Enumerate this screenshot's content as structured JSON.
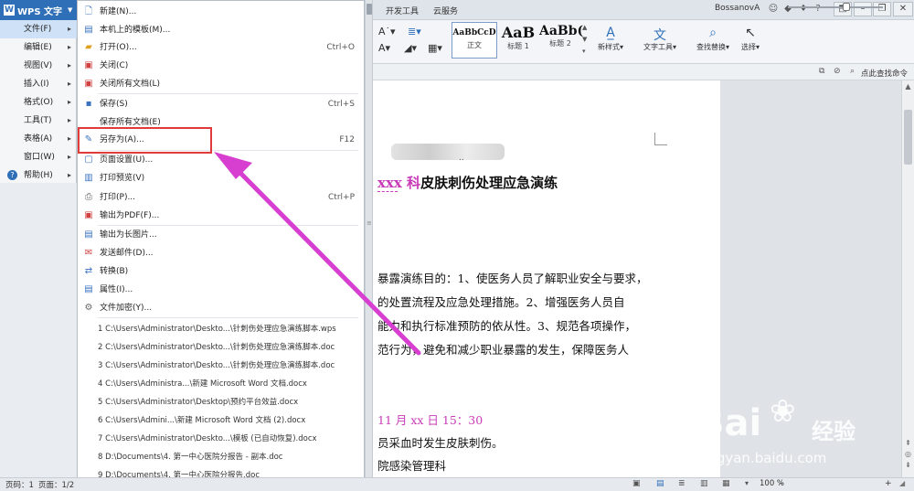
{
  "app": {
    "name": "WPS 文字"
  },
  "ribbon_tabs": [
    "开发工具",
    "云服务"
  ],
  "user": {
    "name": "BossanovA"
  },
  "styles": [
    {
      "preview": "AaBbCcD",
      "label": "正文"
    },
    {
      "preview": "AaB",
      "label": "标题 1"
    },
    {
      "preview": "AaBb(",
      "label": "标题 2"
    }
  ],
  "ribbon_buttons": {
    "new_style": "新样式",
    "text_tools": "文字工具",
    "find_replace": "查找替换",
    "select": "选择"
  },
  "command_hint": "点此查找命令",
  "categories": [
    {
      "label": "文件(F)",
      "icon": "",
      "selected": true
    },
    {
      "label": "编辑(E)",
      "icon": ""
    },
    {
      "label": "视图(V)",
      "icon": ""
    },
    {
      "label": "插入(I)",
      "icon": ""
    },
    {
      "label": "格式(O)",
      "icon": ""
    },
    {
      "label": "工具(T)",
      "icon": ""
    },
    {
      "label": "表格(A)",
      "icon": ""
    },
    {
      "label": "窗口(W)",
      "icon": ""
    },
    {
      "label": "帮助(H)",
      "icon": "help-icon"
    }
  ],
  "menu": {
    "items": [
      {
        "label": "新建(N)...",
        "shortcut": "",
        "icon": "new-doc-icon"
      },
      {
        "label": "本机上的模板(M)...",
        "shortcut": "",
        "icon": "template-icon"
      },
      {
        "label": "打开(O)...",
        "shortcut": "Ctrl+O",
        "icon": "open-folder-icon"
      },
      {
        "label": "关闭(C)",
        "shortcut": "",
        "icon": "close-doc-icon"
      },
      {
        "label": "关闭所有文档(L)",
        "shortcut": "",
        "icon": "close-all-icon"
      },
      {
        "label": "保存(S)",
        "shortcut": "Ctrl+S",
        "icon": "save-icon"
      },
      {
        "label": "保存所有文档(E)",
        "shortcut": "",
        "icon": ""
      },
      {
        "label": "另存为(A)...",
        "shortcut": "F12",
        "icon": "save-as-icon"
      },
      {
        "label": "页面设置(U)...",
        "shortcut": "",
        "icon": "page-setup-icon"
      },
      {
        "label": "打印预览(V)",
        "shortcut": "",
        "icon": "print-preview-icon"
      },
      {
        "label": "打印(P)...",
        "shortcut": "Ctrl+P",
        "icon": "print-icon"
      },
      {
        "label": "输出为PDF(F)...",
        "shortcut": "",
        "icon": "pdf-icon"
      },
      {
        "label": "输出为长图片...",
        "shortcut": "",
        "icon": "long-image-icon"
      },
      {
        "label": "发送邮件(D)...",
        "shortcut": "",
        "icon": "mail-icon"
      },
      {
        "label": "转换(B)",
        "shortcut": "",
        "icon": "convert-icon"
      },
      {
        "label": "属性(I)...",
        "shortcut": "",
        "icon": "properties-icon"
      },
      {
        "label": "文件加密(Y)...",
        "shortcut": "",
        "icon": "encrypt-icon"
      }
    ],
    "recent": [
      "1 C:\\Users\\Administrator\\Deskto...\\针刺伤处理应急演练脚本.wps",
      "2 C:\\Users\\Administrator\\Deskto...\\针刺伤处理应急演练脚本.doc",
      "3 C:\\Users\\Administrator\\Deskto...\\针刺伤处理应急演练脚本.doc",
      "4 C:\\Users\\Administra...\\新建 Microsoft Word 文档.docx",
      "5 C:\\Users\\Administrator\\Desktop\\预约平台效益.docx",
      "6 C:\\Users\\Admini...\\新建 Microsoft Word 文档 (2).docx",
      "7 C:\\Users\\Administrator\\Deskto...\\模板 (已自动恢复).docx",
      "8 D:\\Documents\\4. 第一中心医院分报告 - 副本.doc",
      "9 D:\\Documents\\4. 第一中心医院分报告.doc"
    ]
  },
  "document": {
    "blurred_text": "..",
    "title_highlight": "xxx 科",
    "title_rest": "皮肤刺伤处理应急演练",
    "lines": [
      "暴露演练目的：1、使医务人员了解职业安全与要求，",
      "的处置流程及应急处理措施。2、增强医务人员自",
      "能力和执行标准预防的依从性。3、规范各项操作，",
      "范行为，避免和减少职业暴露的发生，保障医务人"
    ],
    "date_line": "11 月 xx 日  15：30",
    "line_after_date": "员采血时发生皮肤刺伤。",
    "last_line": "院感染管理科"
  },
  "status": {
    "page_num": "页码：1",
    "pages": "页面：1/2",
    "zoom": "100 %"
  },
  "watermark": {
    "brand": "Bai",
    "brand_cn": "经验",
    "url": "jingyan.baidu.com"
  },
  "colors": {
    "accent": "#2e6fb8",
    "highlight_box": "#e03a3a",
    "arrow": "#d63fd0",
    "title_pink": "#c93ab8"
  }
}
